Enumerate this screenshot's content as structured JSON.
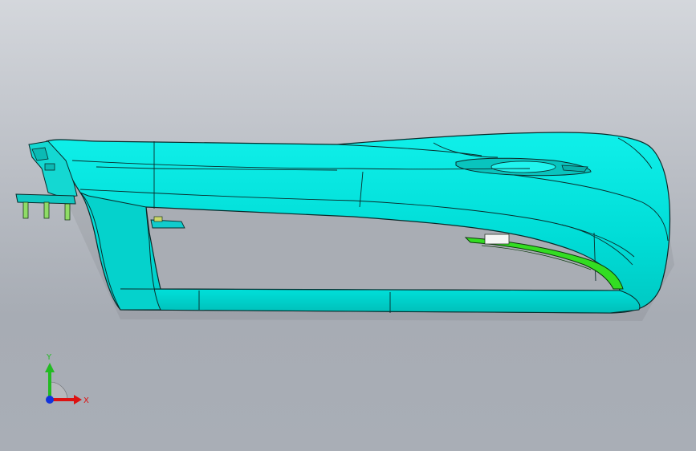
{
  "viewport": {
    "background_top": "#d4d7dc",
    "background_bottom": "#a9aeb6"
  },
  "model": {
    "part_name": "front-bumper",
    "body_color": "#00e5e0",
    "edge_color": "#0a2a2a",
    "shade_color": "#00b8b4",
    "highlight_part_color": "#33dd22",
    "bracket_color": "#11cccc"
  },
  "triad": {
    "x_label": "X",
    "y_label": "Y",
    "x_color": "#dd1111",
    "y_color": "#22bb22",
    "z_color": "#1133dd"
  }
}
